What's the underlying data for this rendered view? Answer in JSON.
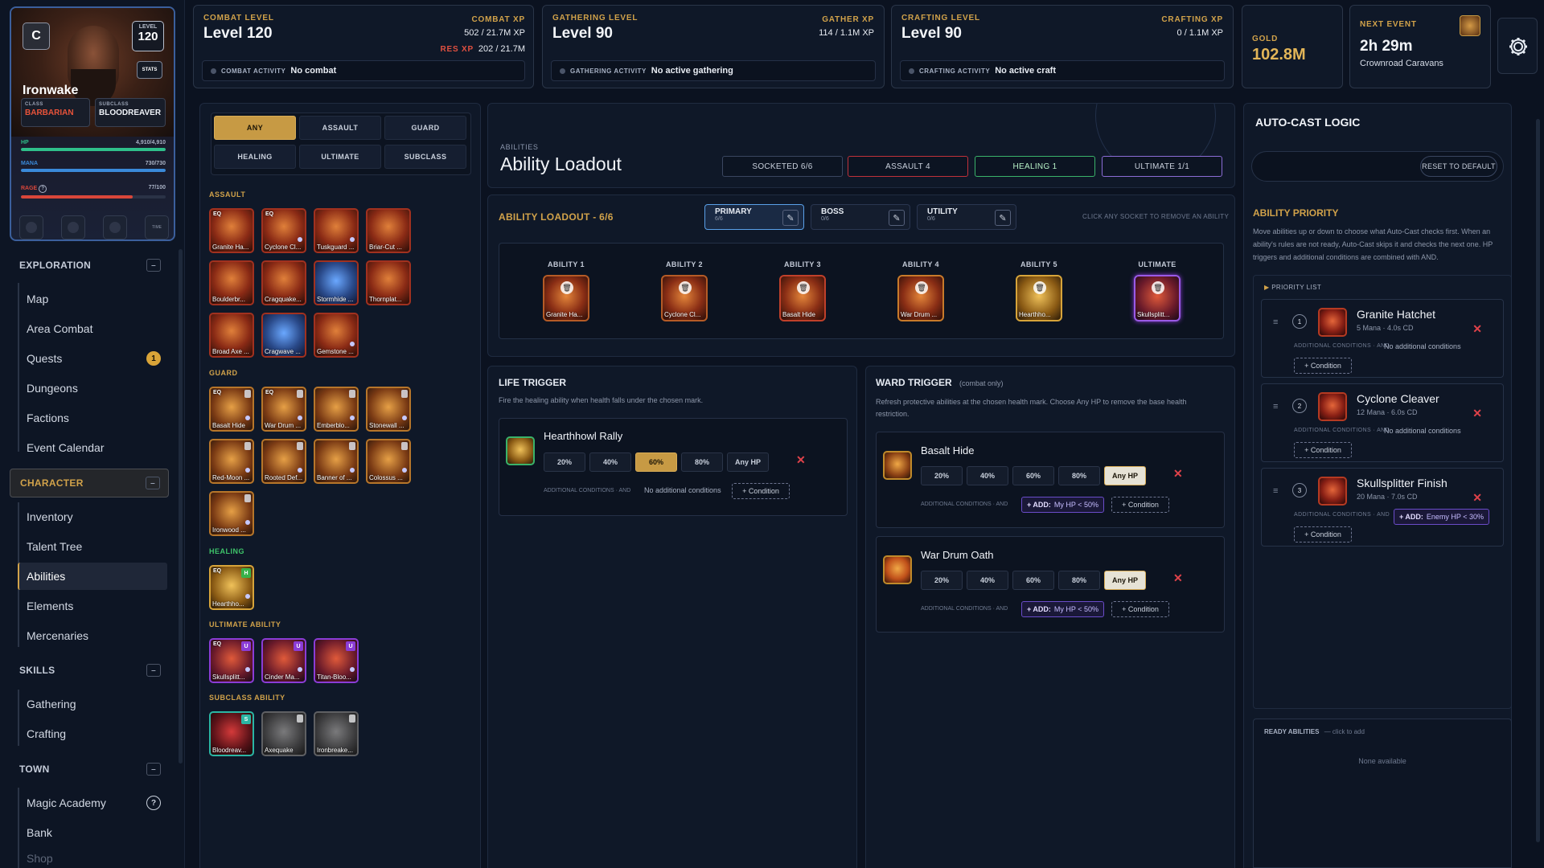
{
  "character": {
    "badge_letter": "C",
    "level_label": "LEVEL",
    "level": "120",
    "stats_label": "STATS",
    "name": "Ironwake",
    "class_label": "CLASS",
    "class_value": "BARBARIAN",
    "subclass_label": "SUBCLASS",
    "subclass_value": "BLOODREAVER",
    "hp_label": "HP",
    "hp_value": "4,910/4,910",
    "hp_fraction": 1.0,
    "mana_label": "MANA",
    "mana_value": "730/730",
    "mana_fraction": 1.0,
    "rage_label": "RAGE",
    "rage_help": "?",
    "rage_value": "77/100",
    "rage_fraction": 0.77,
    "slot_text": "TIME",
    "colors": {
      "hp": "#2fbf8a",
      "mana": "#3a8ad9",
      "rage": "#d9463a",
      "class": "#e8533a"
    }
  },
  "nav": {
    "sections": [
      {
        "label": "EXPLORATION",
        "ctl": "–"
      },
      {
        "label": "CHARACTER",
        "ctl": "–"
      },
      {
        "label": "SKILLS",
        "ctl": "–"
      },
      {
        "label": "TOWN",
        "ctl": "–"
      }
    ],
    "exploration": [
      "Map",
      "Area Combat",
      "Quests",
      "Dungeons",
      "Factions",
      "Event Calendar"
    ],
    "quests_badge": "1",
    "character": [
      "Inventory",
      "Talent Tree",
      "Abilities",
      "Elements",
      "Mercenaries"
    ],
    "active_item": "Abilities",
    "skills": [
      "Gathering",
      "Crafting"
    ],
    "town": [
      "Magic Academy",
      "Bank",
      "Shop"
    ],
    "magic_academy_badge": "?"
  },
  "top": {
    "combat": {
      "label": "COMBAT LEVEL",
      "level": "Level 120",
      "xp_label": "COMBAT XP",
      "xp_value": "502 / 21.7M XP",
      "res_label": "RES XP",
      "res_value": "202 / 21.7M",
      "activity_label": "COMBAT ACTIVITY",
      "activity_value": "No combat"
    },
    "gathering": {
      "label": "GATHERING LEVEL",
      "level": "Level 90",
      "xp_label": "GATHER XP",
      "xp_value": "114 / 1.1M XP",
      "activity_label": "GATHERING ACTIVITY",
      "activity_value": "No active gathering"
    },
    "crafting": {
      "label": "CRAFTING LEVEL",
      "level": "Level 90",
      "xp_label": "CRAFTING XP",
      "xp_value": "0 / 1.1M XP",
      "activity_label": "CRAFTING ACTIVITY",
      "activity_value": "No active craft"
    },
    "gold": {
      "label": "GOLD",
      "value": "102.8M"
    },
    "event": {
      "label": "NEXT EVENT",
      "time": "2h 29m",
      "name": "Crownroad Caravans"
    },
    "settings_icon": "gear-icon"
  },
  "filters": [
    "ANY",
    "ASSAULT",
    "GUARD",
    "HEALING",
    "ULTIMATE",
    "SUBCLASS"
  ],
  "list": {
    "assault_label": "ASSAULT",
    "assault": [
      "Granite Ha...",
      "Cyclone Cl...",
      "Tuskguard ...",
      "Briar-Cut ...",
      "Boulderbr...",
      "Cragquake...",
      "Stormhide ...",
      "Thornplat...",
      "Broad Axe ...",
      "Cragwave ...",
      "Gemstone ..."
    ],
    "guard_label": "GUARD",
    "guard": [
      "Basalt Hide",
      "War Drum ...",
      "Emberblo...",
      "Stonewall ...",
      "Red-Moon ...",
      "Rooted Def...",
      "Banner of ...",
      "Colossus ...",
      "Ironwood ..."
    ],
    "healing_label": "HEALING",
    "healing": [
      "Hearthho..."
    ],
    "ultimate_label": "ULTIMATE ABILITY",
    "ultimate": [
      "Skullsplitt...",
      "Cinder Ma...",
      "Titan-Bloo..."
    ],
    "subclass_label": "SUBCLASS ABILITY",
    "subclass": [
      "Bloodreav...",
      "Axequake",
      "Ironbreake..."
    ],
    "eq_tag": "EQ",
    "u_tag": "U",
    "s_tag": "S",
    "h_tag": "H"
  },
  "header": {
    "crumb": "ABILITIES",
    "title": "Ability Loadout",
    "chips": [
      "SOCKETED 6/6",
      "ASSAULT 4",
      "HEALING 1",
      "ULTIMATE 1/1"
    ]
  },
  "loadout": {
    "title": "ABILITY LOADOUT - 6/6",
    "tabs": [
      {
        "label": "PRIMARY",
        "sub": "6/6"
      },
      {
        "label": "BOSS",
        "sub": "0/6"
      },
      {
        "label": "UTILITY",
        "sub": "0/6"
      }
    ],
    "hint": "CLICK ANY SOCKET TO REMOVE AN ABILITY",
    "sockets": [
      {
        "label": "ABILITY 1",
        "name": "Granite Ha..."
      },
      {
        "label": "ABILITY 2",
        "name": "Cyclone Cl..."
      },
      {
        "label": "ABILITY 3",
        "name": "Basalt Hide"
      },
      {
        "label": "ABILITY 4",
        "name": "War Drum ..."
      },
      {
        "label": "ABILITY 5",
        "name": "Hearthho..."
      },
      {
        "label": "ULTIMATE",
        "name": "Skullsplitt..."
      }
    ]
  },
  "life_trigger": {
    "title": "LIFE TRIGGER",
    "desc": "Fire the healing ability when health falls under the chosen mark.",
    "ability": "Hearthhowl Rally",
    "options": [
      "20%",
      "40%",
      "60%",
      "80%",
      "Any HP"
    ],
    "selected": "60%",
    "cond_label": "ADDITIONAL CONDITIONS · AND",
    "cond_value": "No additional conditions",
    "cond_btn": "+ Condition"
  },
  "ward_trigger": {
    "title": "WARD TRIGGER",
    "tag": "(combat only)",
    "desc": "Refresh protective abilities at the chosen health mark. Choose Any HP to remove the base health restriction.",
    "items": [
      {
        "ability": "Basalt Hide",
        "selected": "Any HP",
        "add_key": "+ ADD:",
        "add_value": "My HP < 50%"
      },
      {
        "ability": "War Drum Oath",
        "selected": "Any HP",
        "add_key": "+ ADD:",
        "add_value": "My HP < 50%"
      }
    ],
    "options": [
      "20%",
      "40%",
      "60%",
      "80%",
      "Any HP"
    ],
    "cond_label": "ADDITIONAL CONDITIONS · AND",
    "cond_btn": "+ Condition"
  },
  "autocast": {
    "title": "AUTO-CAST LOGIC",
    "reset": "RESET TO DEFAULT",
    "priority_title": "ABILITY PRIORITY",
    "priority_desc": "Move abilities up or down to choose what Auto-Cast checks first. When an ability's rules are not ready, Auto-Cast skips it and checks the next one. HP triggers and additional conditions are combined with AND.",
    "list_label": "PRIORITY LIST",
    "items": [
      {
        "num": "1",
        "name": "Granite Hatchet",
        "meta": "5 Mana · 4.0s CD",
        "cond": "No additional conditions"
      },
      {
        "num": "2",
        "name": "Cyclone Cleaver",
        "meta": "12 Mana · 6.0s CD",
        "cond": "No additional conditions"
      },
      {
        "num": "3",
        "name": "Skullsplitter Finish",
        "meta": "20 Mana · 7.0s CD",
        "add_key": "+ ADD:",
        "add_value": "Enemy HP < 30%"
      }
    ],
    "cond_label": "ADDITIONAL CONDITIONS · AND",
    "cond_btn": "+ Condition",
    "ready_label": "READY ABILITIES",
    "ready_hint": "— click to add",
    "ready_empty": "None available"
  }
}
